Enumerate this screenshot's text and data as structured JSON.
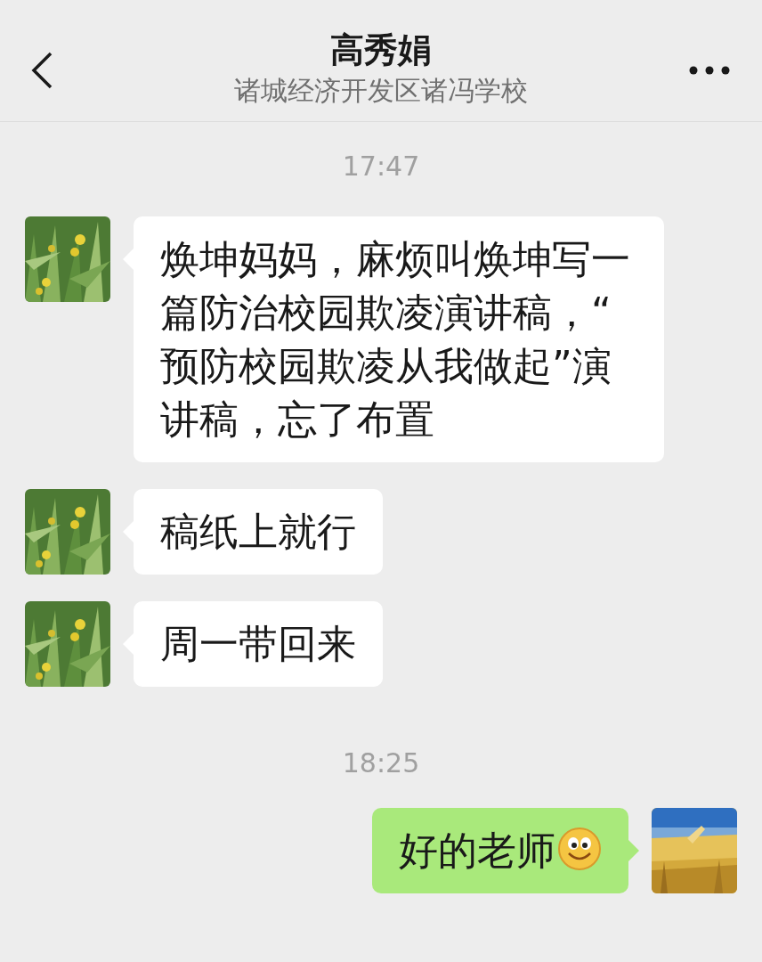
{
  "header": {
    "title": "高秀娟",
    "subtitle": "诸城经济开发区诸冯学校"
  },
  "messages": [
    {
      "kind": "time",
      "text": "17:47"
    },
    {
      "kind": "incoming",
      "text": "焕坤妈妈，麻烦叫焕坤写一篇防治校园欺凌演讲稿，“预防校园欺凌从我做起”演讲稿，忘了布置"
    },
    {
      "kind": "incoming",
      "text": "稿纸上就行"
    },
    {
      "kind": "incoming",
      "text": "周一带回来"
    },
    {
      "kind": "time",
      "text": "18:25"
    },
    {
      "kind": "outgoing",
      "text": "好的老师",
      "emoji": true
    }
  ]
}
